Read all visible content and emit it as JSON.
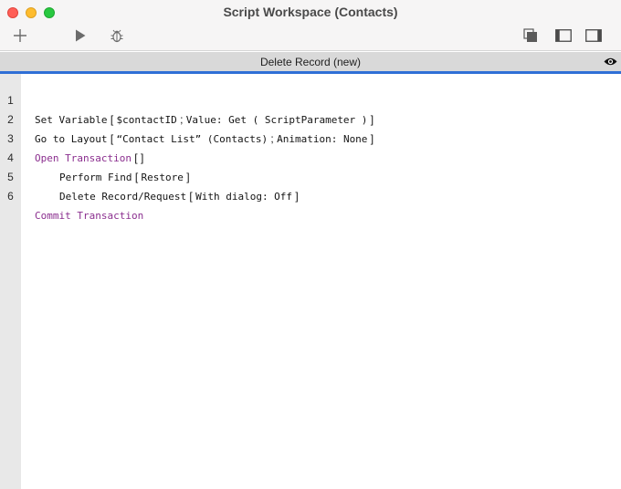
{
  "window": {
    "title": "Script Workspace (Contacts)"
  },
  "toolbar": {
    "icons": [
      "plus-icon",
      "play-icon",
      "bug-icon",
      "copy-window-icon",
      "left-panel-icon",
      "right-panel-icon"
    ]
  },
  "tab": {
    "label": "Delete Record (new)",
    "icon": "eye-icon",
    "accent_color": "#2f6fd6"
  },
  "colors": {
    "control_keyword": "#8b2f8f",
    "gutter": "#e8e8e8",
    "tab_background": "#d9d9d9"
  },
  "script": {
    "lines": [
      {
        "number": "1",
        "step": "Set Variable",
        "open": " [ ",
        "p1": "$contactID",
        "sep": " ; ",
        "p2": "Value: Get ( ScriptParameter )",
        "close": " ]"
      },
      {
        "number": "2",
        "step": "Go to Layout",
        "open": " [ ",
        "p1": "“Contact List” (Contacts)",
        "sep": " ; ",
        "p2": "Animation: None",
        "close": " ]"
      },
      {
        "number": "3",
        "step": "Open Transaction",
        "bracket": " [ ]"
      },
      {
        "number": "4",
        "step": "Perform Find",
        "open": " [ ",
        "p1": "Restore",
        "close": " ]"
      },
      {
        "number": "5",
        "step": "Delete Record/Request",
        "open": " [ ",
        "p1": "With dialog: Off",
        "close": " ]"
      },
      {
        "number": "6",
        "step": "Commit Transaction"
      }
    ]
  }
}
